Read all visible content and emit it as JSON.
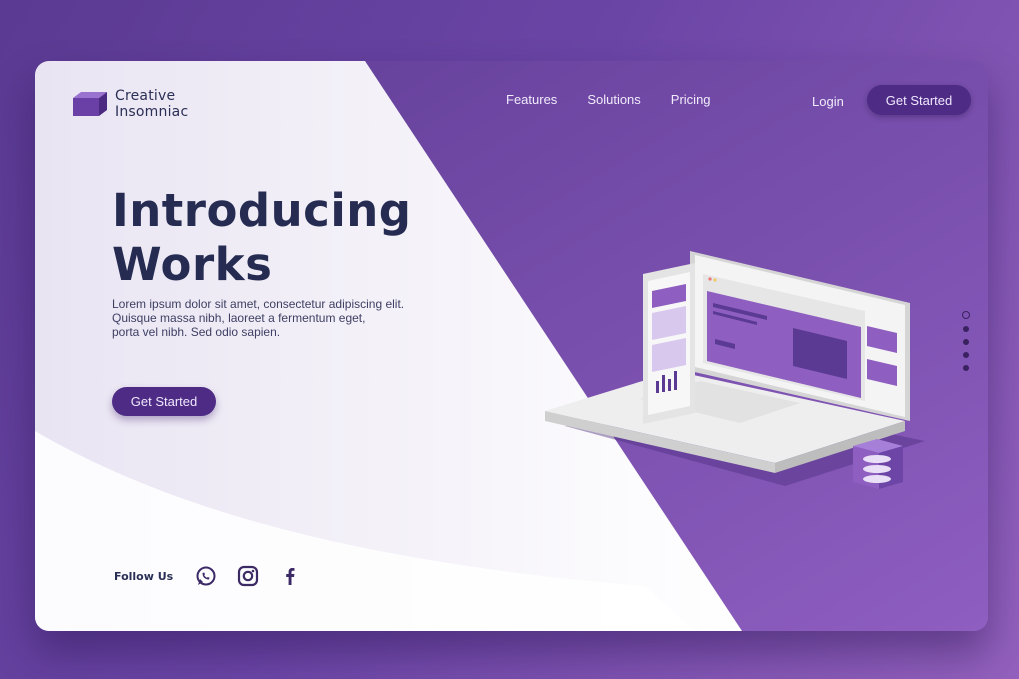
{
  "brand": {
    "line1": "Creative",
    "line2": "Insomniac"
  },
  "nav": {
    "items": [
      {
        "label": "Features"
      },
      {
        "label": "Solutions"
      },
      {
        "label": "Pricing"
      }
    ],
    "login_label": "Login",
    "cta_label": "Get Started"
  },
  "hero": {
    "title_line1": "Introducing",
    "title_line2": "Works",
    "desc_line1": "Lorem ipsum dolor sit amet, consectetur adipiscing elit.",
    "desc_line2": "Quisque massa nibh, laoreet a fermentum eget,",
    "desc_line3": "porta vel nibh. Sed odio sapien.",
    "cta_label": "Get Started"
  },
  "follow": {
    "label": "Follow Us",
    "icons": [
      "whatsapp-icon",
      "instagram-icon",
      "facebook-icon"
    ]
  },
  "pagination": {
    "total": 5,
    "active_index": 0
  },
  "colors": {
    "accent": "#4e2c85",
    "primary_purple": "#6c46a5",
    "heading": "#262b52",
    "light_panel": "#f6f3fb"
  }
}
